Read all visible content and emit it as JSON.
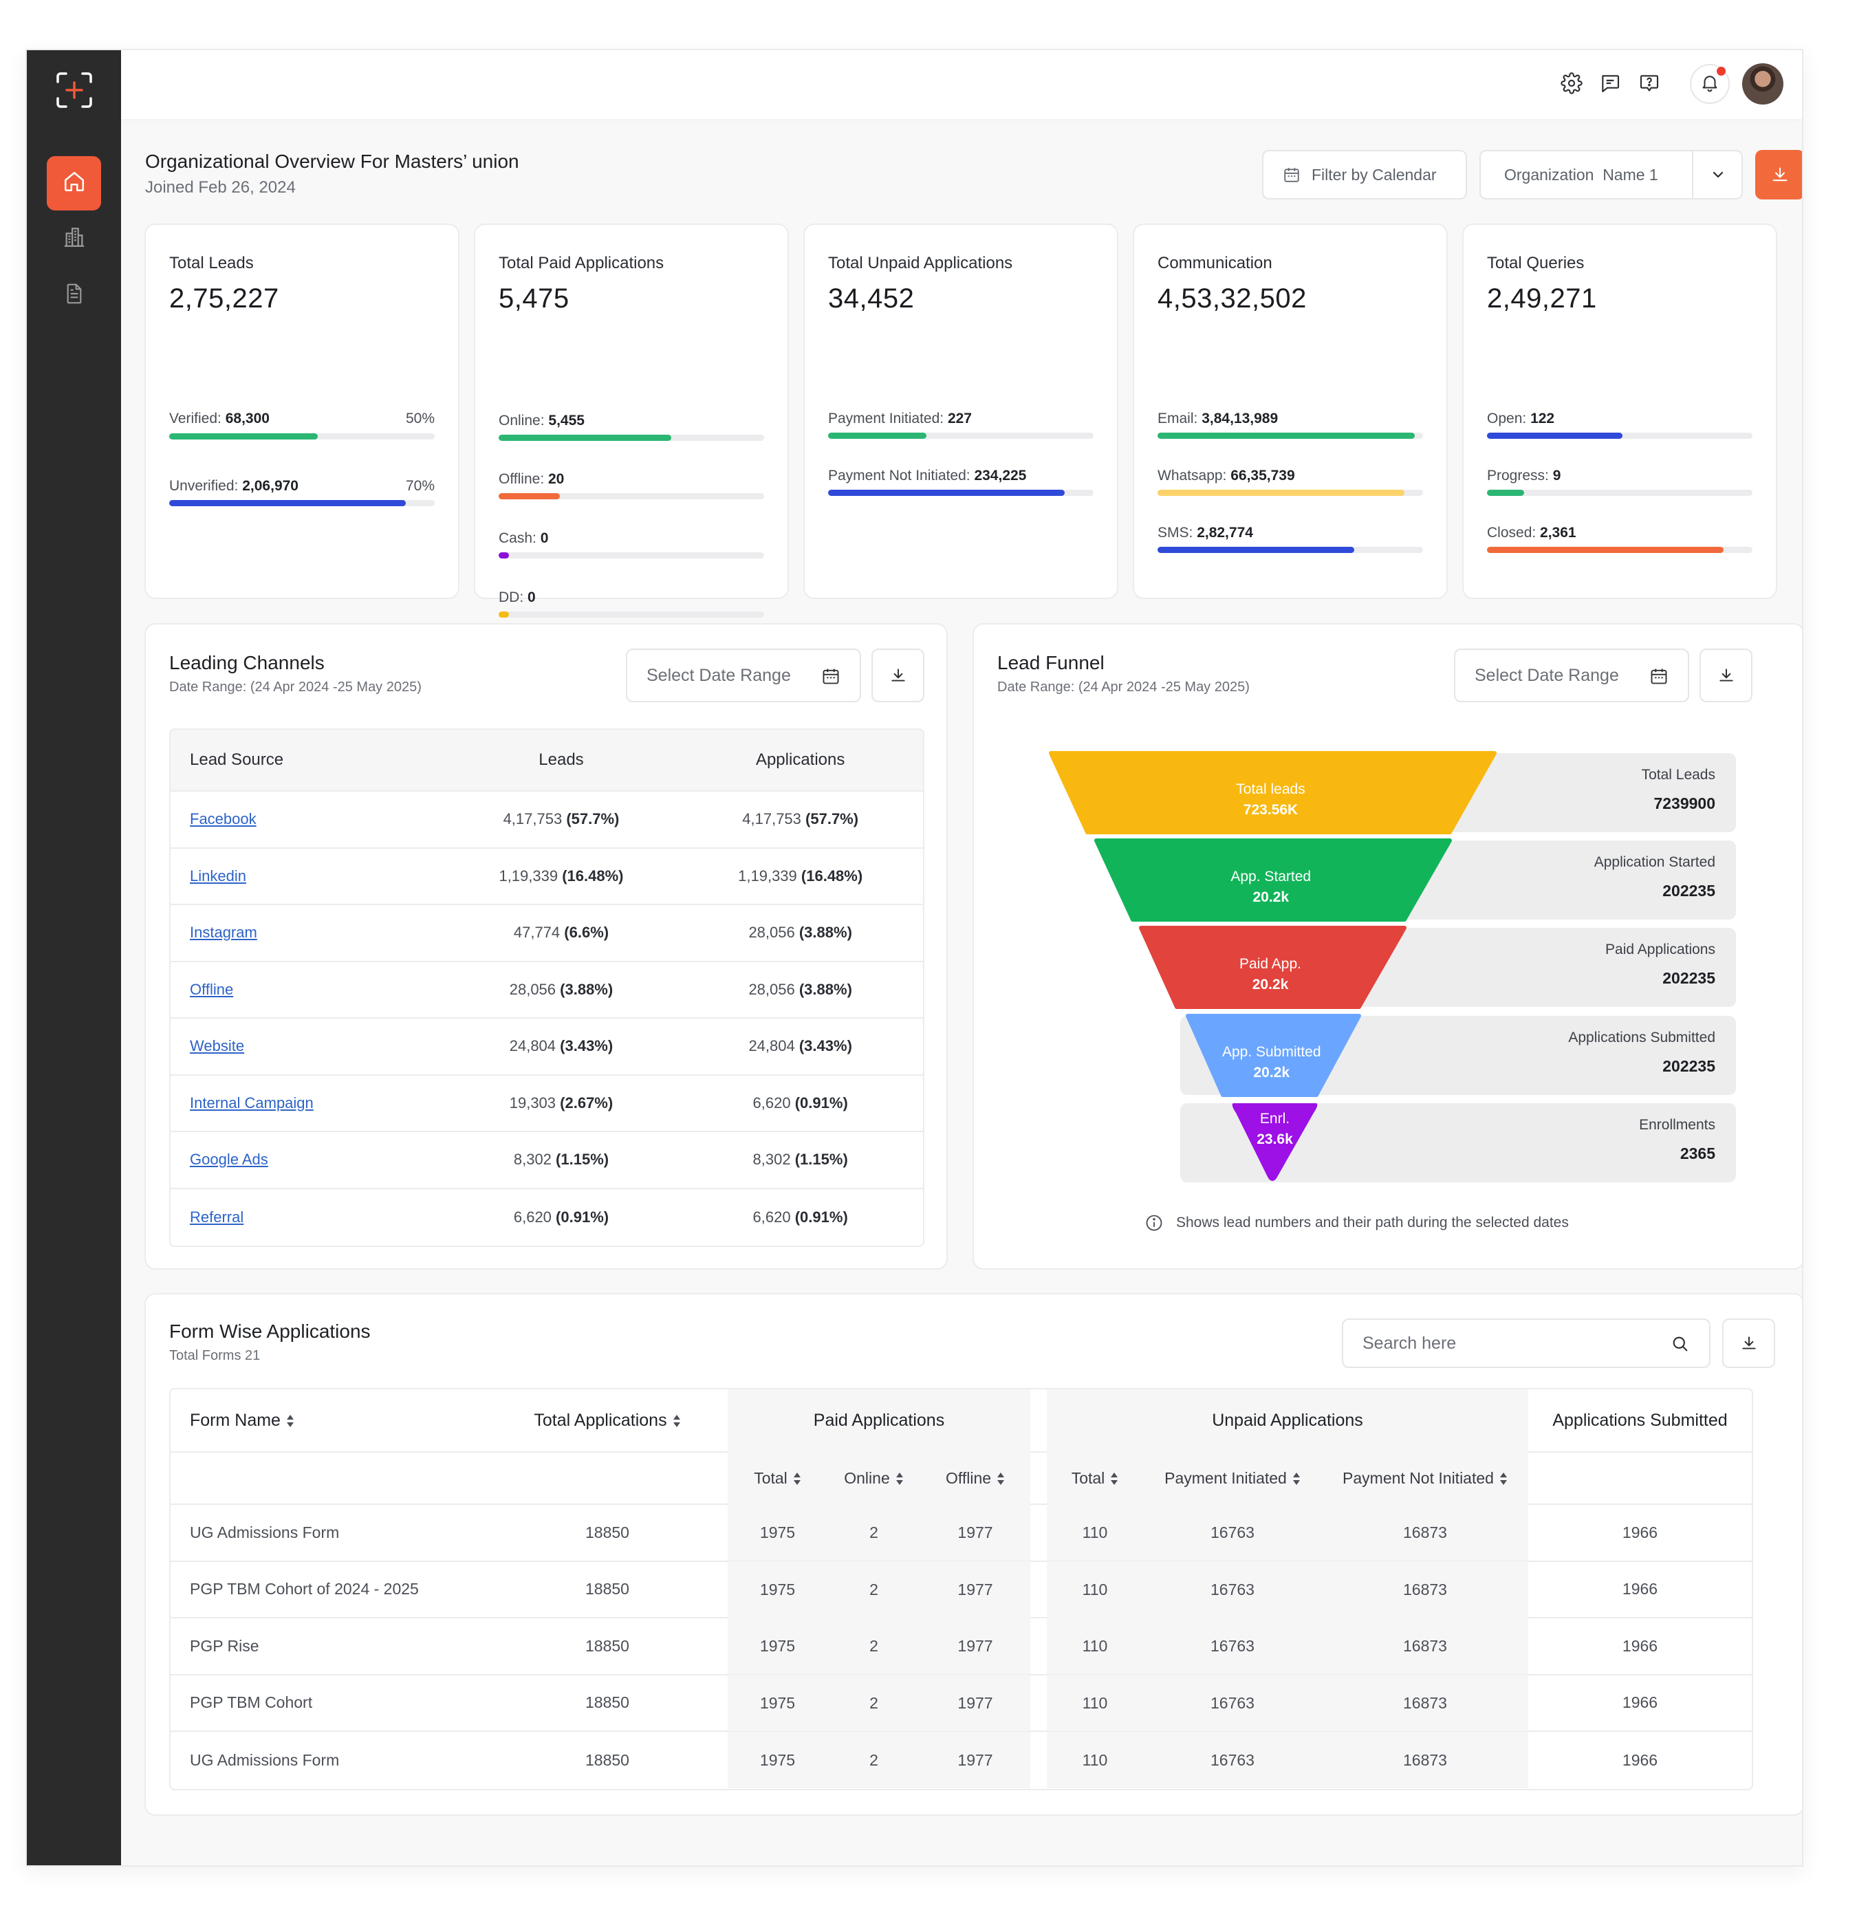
{
  "header": {
    "title": "Organizational Overview For Masters’ union",
    "joined": "Joined Feb 26, 2024",
    "filter_calendar_label": "Filter by Calendar",
    "organization_select": "Organization  Name 1"
  },
  "stats": [
    {
      "title": "Total Leads",
      "value": "2,75,227",
      "bars": [
        {
          "label": "Verified:",
          "value": "68,300",
          "pct": "50%",
          "fraction": 0.56,
          "color": "#2bb673"
        },
        {
          "label": "Unverified:",
          "value": "2,06,970",
          "pct": "70%",
          "fraction": 0.89,
          "color": "#2f4ad8"
        }
      ]
    },
    {
      "title": "Total Paid Applications",
      "value": "5,475",
      "bars": [
        {
          "label": "Online:",
          "value": "5,455",
          "fraction": 0.65,
          "color": "#2bb673"
        },
        {
          "label": "Offline:",
          "value": "20",
          "fraction": 0.23,
          "color": "#f26a3b"
        },
        {
          "label": "Cash:",
          "value": "0",
          "fraction": 0.04,
          "color": "#8b11d8"
        },
        {
          "label": "DD:",
          "value": "0",
          "fraction": 0.04,
          "color": "#f5bb16"
        }
      ]
    },
    {
      "title": "Total Unpaid Applications",
      "value": "34,452",
      "bars": [
        {
          "label": "Payment Initiated:",
          "value": "227",
          "fraction": 0.37,
          "color": "#2bb673"
        },
        {
          "label": "Payment Not Initiated:",
          "value": "234,225",
          "fraction": 0.89,
          "color": "#2f4ad8"
        }
      ]
    },
    {
      "title": "Communication",
      "value": "4,53,32,502",
      "bars": [
        {
          "label": "Email:",
          "value": "3,84,13,989",
          "fraction": 0.97,
          "color": "#2bb673"
        },
        {
          "label": "Whatsapp:",
          "value": "66,35,739",
          "fraction": 0.93,
          "color": "#fbd36a"
        },
        {
          "label": "SMS:",
          "value": "2,82,774",
          "fraction": 0.74,
          "color": "#2f4ad8"
        }
      ]
    },
    {
      "title": "Total Queries",
      "value": "2,49,271",
      "bars": [
        {
          "label": "Open:",
          "value": "122",
          "fraction": 0.51,
          "color": "#2f4ad8"
        },
        {
          "label": "Progress:",
          "value": "9",
          "fraction": 0.14,
          "color": "#2bb673"
        },
        {
          "label": "Closed:",
          "value": "2,361",
          "fraction": 0.89,
          "color": "#f26a3b"
        }
      ]
    }
  ],
  "leading_channels": {
    "title": "Leading Channels",
    "date_range": "Date Range: (24 Apr 2024 -25 May 2025)",
    "select_date_placeholder": "Select Date Range",
    "columns": [
      "Lead Source",
      "Leads",
      "Applications"
    ],
    "rows": [
      {
        "source": "Facebook",
        "leads": "4,17,753",
        "leads_pct": "(57.7%)",
        "apps": "4,17,753",
        "apps_pct": "(57.7%)"
      },
      {
        "source": "Linkedin",
        "leads": "1,19,339",
        "leads_pct": "(16.48%)",
        "apps": "1,19,339",
        "apps_pct": "(16.48%)"
      },
      {
        "source": "Instagram",
        "leads": "47,774",
        "leads_pct": "(6.6%)",
        "apps": "28,056",
        "apps_pct": "(3.88%)"
      },
      {
        "source": "Offline",
        "leads": "28,056",
        "leads_pct": "(3.88%)",
        "apps": "28,056",
        "apps_pct": "(3.88%)"
      },
      {
        "source": "Website",
        "leads": "24,804",
        "leads_pct": "(3.43%)",
        "apps": "24,804",
        "apps_pct": "(3.43%)"
      },
      {
        "source": "Internal Campaign",
        "leads": "19,303",
        "leads_pct": "(2.67%)",
        "apps": "6,620",
        "apps_pct": "(0.91%)"
      },
      {
        "source": "Google Ads",
        "leads": "8,302",
        "leads_pct": "(1.15%)",
        "apps": "8,302",
        "apps_pct": "(1.15%)"
      },
      {
        "source": "Referral",
        "leads": "6,620",
        "leads_pct": "(0.91%)",
        "apps": "6,620",
        "apps_pct": "(0.91%)"
      }
    ]
  },
  "lead_funnel": {
    "title": "Lead Funnel",
    "date_range": "Date Range: (24 Apr 2024 -25 May 2025)",
    "select_date_placeholder": "Select Date Range",
    "note": "Shows lead numbers and their path during the selected dates",
    "stages": [
      {
        "name": "Total leads",
        "value": "723.56K",
        "label": "Total Leads",
        "label_value": "7239900",
        "color": "#f8b80f"
      },
      {
        "name": "App. Started",
        "value": "20.2k",
        "label": "Application Started",
        "label_value": "202235",
        "color": "#12b45a"
      },
      {
        "name": "Paid App.",
        "value": "20.2k",
        "label": "Paid Applications",
        "label_value": "202235",
        "color": "#e2433c"
      },
      {
        "name": "App. Submitted",
        "value": "20.2k",
        "label": "Applications Submitted",
        "label_value": "202235",
        "color": "#6aa6ff"
      },
      {
        "name": "Enrl.",
        "value": "23.6k",
        "label": "Enrollments",
        "label_value": "2365",
        "color": "#9d10e6"
      }
    ]
  },
  "form_wise": {
    "title": "Form Wise Applications",
    "total_forms": "Total Forms 21",
    "search_placeholder": "Search here",
    "headers": {
      "form_name": "Form Name",
      "total_applications": "Total Applications",
      "paid": "Paid Applications",
      "unpaid": "Unpaid Applications",
      "submitted": "Applications Submitted"
    },
    "subheaders": {
      "paid_total": "Total",
      "paid_online": "Online",
      "paid_offline": "Offline",
      "unpaid_total": "Total",
      "unpaid_initiated": "Payment Initiated",
      "unpaid_not_initiated": "Payment Not Initiated"
    },
    "rows": [
      {
        "form": "UG Admissions Form",
        "total": "18850",
        "p_total": "1975",
        "p_online": "2",
        "p_offline": "1977",
        "u_total": "110",
        "u_init": "16763",
        "u_not": "16873",
        "submitted": "1966"
      },
      {
        "form": "PGP TBM Cohort of 2024 - 2025",
        "total": "18850",
        "p_total": "1975",
        "p_online": "2",
        "p_offline": "1977",
        "u_total": "110",
        "u_init": "16763",
        "u_not": "16873",
        "submitted": "1966"
      },
      {
        "form": "PGP Rise",
        "total": "18850",
        "p_total": "1975",
        "p_online": "2",
        "p_offline": "1977",
        "u_total": "110",
        "u_init": "16763",
        "u_not": "16873",
        "submitted": "1966"
      },
      {
        "form": "PGP TBM Cohort",
        "total": "18850",
        "p_total": "1975",
        "p_online": "2",
        "p_offline": "1977",
        "u_total": "110",
        "u_init": "16763",
        "u_not": "16873",
        "submitted": "1966"
      },
      {
        "form": "UG Admissions Form",
        "total": "18850",
        "p_total": "1975",
        "p_online": "2",
        "p_offline": "1977",
        "u_total": "110",
        "u_init": "16763",
        "u_not": "16873",
        "submitted": "1966"
      }
    ]
  },
  "icons": {
    "logo": "brand-plus-logo",
    "sidebar": [
      "home-icon",
      "building-icon",
      "document-icon"
    ],
    "topbar": [
      "gear-icon",
      "message-icon",
      "help-icon",
      "bell-icon"
    ],
    "accent_color": "#f15a38"
  }
}
